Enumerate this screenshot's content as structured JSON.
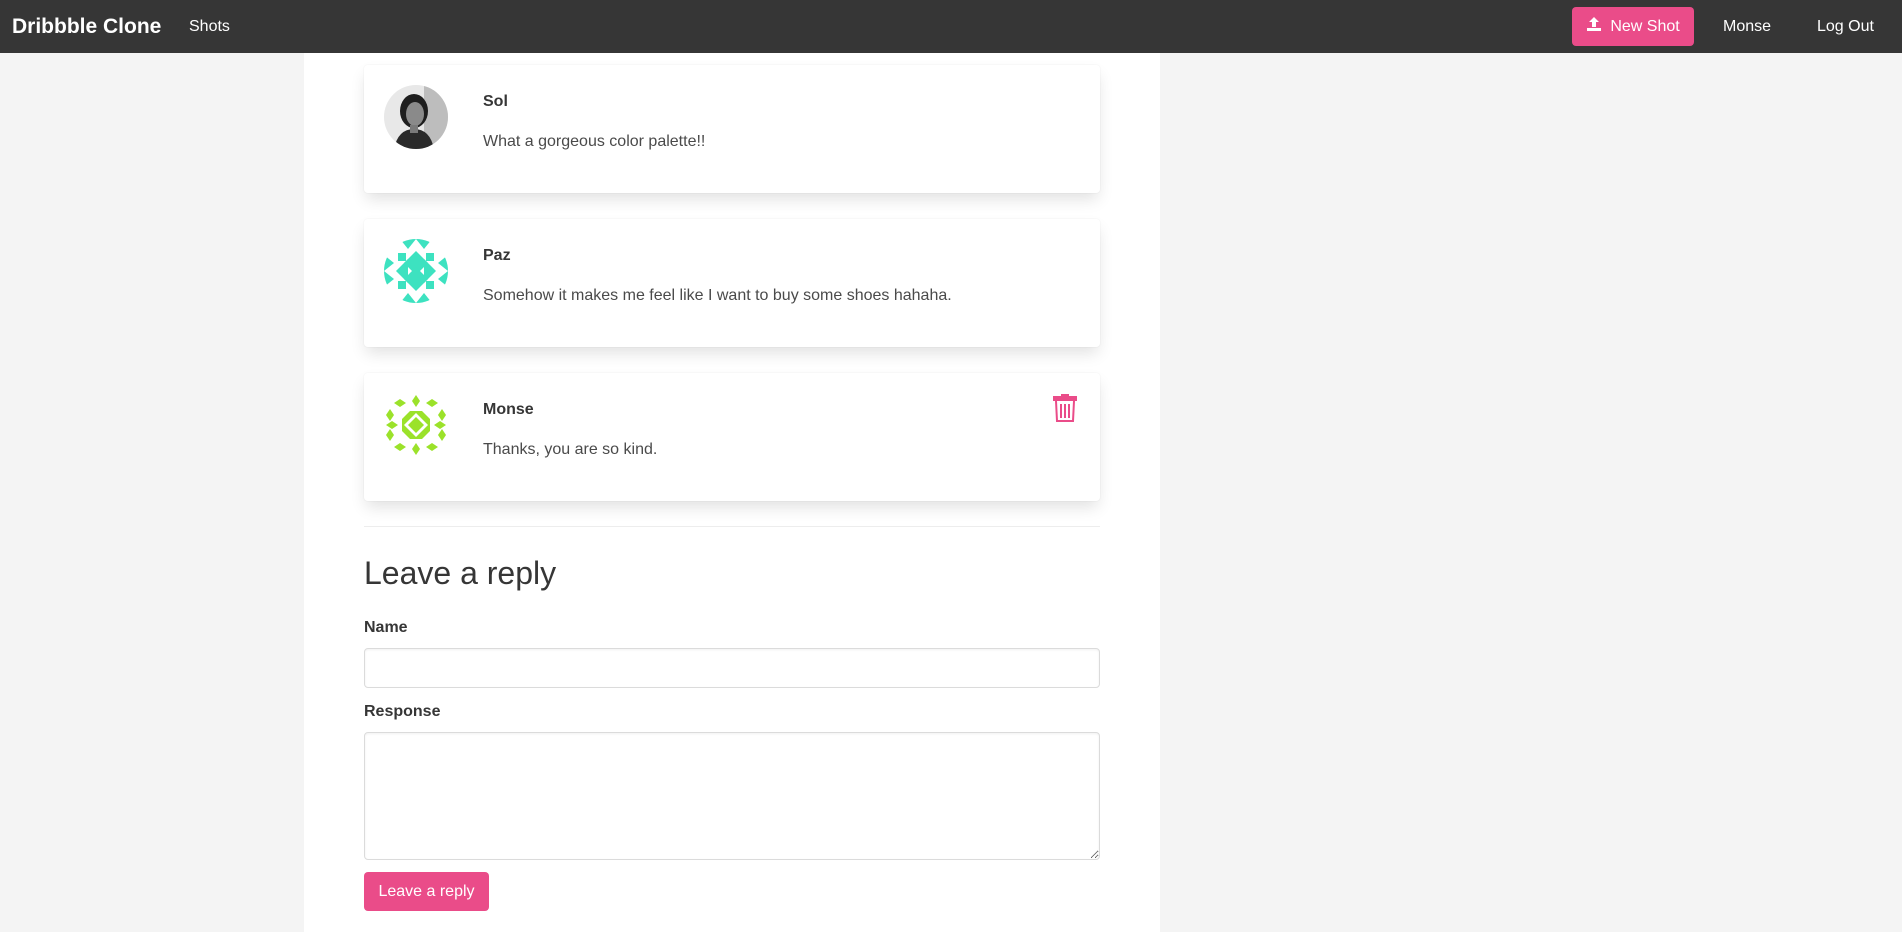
{
  "navbar": {
    "brand": "Dribbble Clone",
    "shots_link": "Shots",
    "new_shot_button": "New Shot",
    "user_link": "Monse",
    "logout_link": "Log Out",
    "accent_color": "#ea4c89",
    "background_color": "#363636"
  },
  "comments": [
    {
      "name": "Sol",
      "text": "What a gorgeous color palette!!",
      "avatar_icon": "user-photo-avatar",
      "can_delete": false
    },
    {
      "name": "Paz",
      "text": "Somehow it makes me feel like I want to buy some shoes hahaha.",
      "avatar_icon": "teal-identicon-avatar",
      "can_delete": false
    },
    {
      "name": "Monse",
      "text": "Thanks, you are so kind.",
      "avatar_icon": "green-identicon-avatar",
      "can_delete": true
    }
  ],
  "reply_form": {
    "title": "Leave a reply",
    "name_label": "Name",
    "name_value": "",
    "response_label": "Response",
    "response_value": "",
    "submit_label": "Leave a reply"
  }
}
